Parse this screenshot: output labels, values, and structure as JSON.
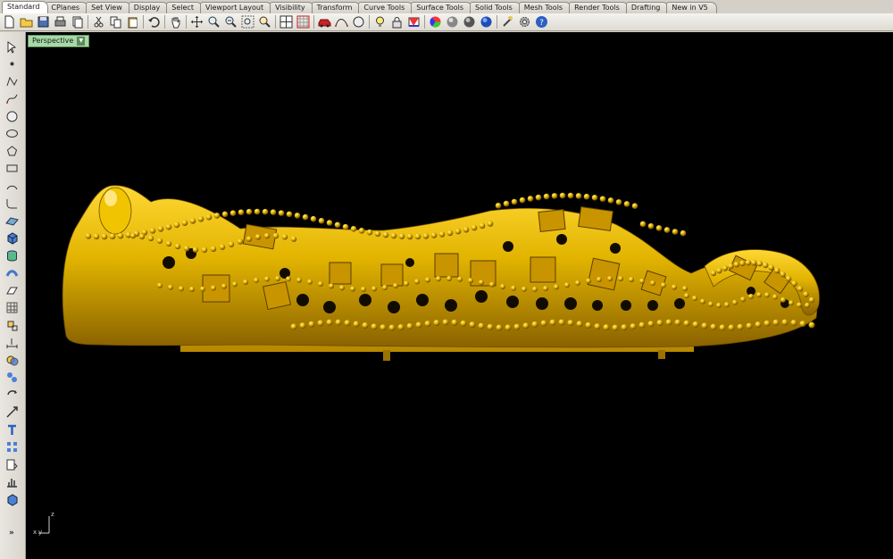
{
  "tabs": [
    {
      "label": "Standard",
      "active": true
    },
    {
      "label": "CPlanes"
    },
    {
      "label": "Set View"
    },
    {
      "label": "Display"
    },
    {
      "label": "Select"
    },
    {
      "label": "Viewport Layout"
    },
    {
      "label": "Visibility"
    },
    {
      "label": "Transform"
    },
    {
      "label": "Curve Tools"
    },
    {
      "label": "Surface Tools"
    },
    {
      "label": "Solid Tools"
    },
    {
      "label": "Mesh Tools"
    },
    {
      "label": "Render Tools"
    },
    {
      "label": "Drafting"
    },
    {
      "label": "New in V5"
    }
  ],
  "toolbar": {
    "icons": [
      "new-document-icon",
      "open-folder-icon",
      "save-icon",
      "print-icon",
      "import-icon",
      "cut-icon",
      "copy-icon",
      "paste-icon",
      "undo-icon",
      "pan-hand-icon",
      "move-view-icon",
      "zoom-window-icon",
      "zoom-extents-icon",
      "zoom-selected-icon",
      "zoom-all-icon",
      "four-viewports-icon",
      "grid-icon",
      "car-icon",
      "curve-points-icon",
      "circle-icon",
      "light-bulb-icon",
      "lock-icon",
      "color-icon",
      "color-wheel-icon",
      "shaded-sphere-icon",
      "rendered-sphere-icon",
      "blue-sphere-icon",
      "options-icon",
      "gear-icon",
      "help-icon"
    ]
  },
  "left_toolbar": {
    "icons": [
      "select-arrow-icon",
      "point-icon",
      "polyline-icon",
      "curve-icon",
      "circle-icon",
      "ellipse-icon",
      "polygon-icon",
      "rectangle-icon",
      "arc-icon",
      "fillet-icon",
      "surface-icon",
      "box-solid-icon",
      "cylinder-icon",
      "pipe-icon",
      "plane-surface-icon",
      "mesh-icon",
      "transform-icon",
      "dimension-icon",
      "boolean-icon",
      "group-icon",
      "rotate-icon",
      "scale-icon",
      "text-icon",
      "array-icon",
      "block-icon",
      "analyze-icon",
      "render-icon"
    ],
    "more_label": "»"
  },
  "viewport": {
    "title": "Perspective",
    "background": "#000000",
    "axis_labels": {
      "z": "z",
      "x": "x",
      "y": "y"
    }
  },
  "model": {
    "color": "#e2b400",
    "highlight": "#ffe15a",
    "shadow": "#8a6200"
  }
}
